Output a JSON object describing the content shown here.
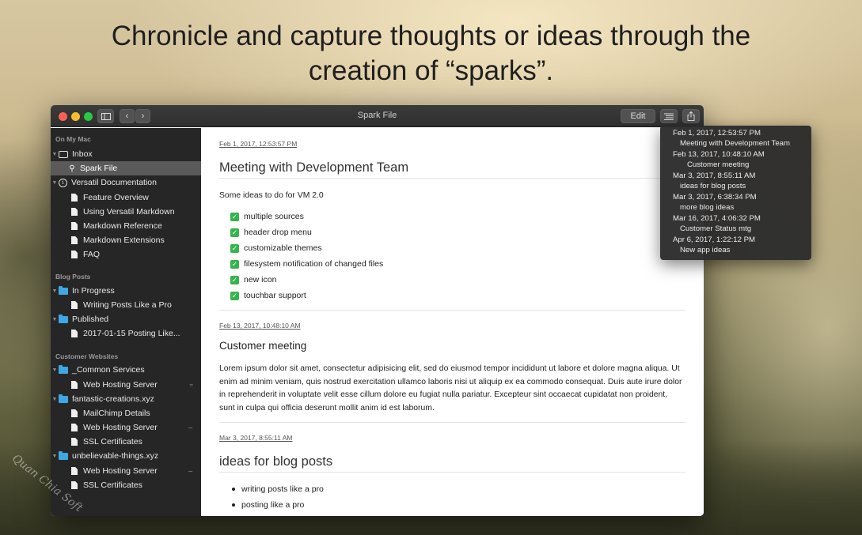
{
  "headline": {
    "line1": "Chronicle and capture thoughts or ideas through the",
    "line2": "creation of “sparks”."
  },
  "window": {
    "title": "Spark File",
    "toolbar": {
      "sidebar_icon": "sidebar-toggle-icon",
      "back": "‹",
      "forward": "›",
      "edit_label": "Edit",
      "outline_icon": "outline-list-icon",
      "share_icon": "share-icon"
    }
  },
  "sidebar": {
    "sections": [
      {
        "header": "On My Mac"
      },
      {
        "header": "Blog Posts"
      },
      {
        "header": "Customer Websites"
      }
    ],
    "items": [
      {
        "label": "Inbox",
        "icon": "inbox-icon"
      },
      {
        "label": "Spark File",
        "icon": "lightbulb-icon",
        "selected": true
      },
      {
        "label": "Versatil Documentation",
        "icon": "info-icon"
      },
      {
        "label": "Feature Overview",
        "icon": "document-icon"
      },
      {
        "label": "Using Versatil Markdown",
        "icon": "document-icon"
      },
      {
        "label": "Markdown Reference",
        "icon": "document-icon"
      },
      {
        "label": "Markdown Extensions",
        "icon": "document-icon"
      },
      {
        "label": "FAQ",
        "icon": "document-icon"
      },
      {
        "label": "In Progress",
        "icon": "folder-icon"
      },
      {
        "label": "Writing  Posts Like a Pro",
        "icon": "document-icon"
      },
      {
        "label": "Published",
        "icon": "folder-icon"
      },
      {
        "label": "2017-01-15 Posting Like...",
        "icon": "document-icon"
      },
      {
        "label": "_Common Services",
        "icon": "folder-icon"
      },
      {
        "label": "Web Hosting Server",
        "icon": "document-icon"
      },
      {
        "label": "fantastic-creations.xyz",
        "icon": "folder-icon"
      },
      {
        "label": "MailChimp Details",
        "icon": "document-icon"
      },
      {
        "label": "Web Hosting Server",
        "icon": "document-icon"
      },
      {
        "label": "SSL Certificates",
        "icon": "document-icon"
      },
      {
        "label": "unbelievable-things.xyz",
        "icon": "folder-icon"
      },
      {
        "label": "Web Hosting Server",
        "icon": "document-icon"
      },
      {
        "label": "SSL Certificates",
        "icon": "document-icon"
      }
    ]
  },
  "content": {
    "entries": [
      {
        "date": "Feb 1, 2017, 12:53:57 PM",
        "title": "Meeting with Development Team",
        "intro": "Some ideas to do for VM 2.0",
        "todos": [
          "multiple sources",
          "header drop menu",
          "customizable themes",
          "filesystem notification of changed files",
          "new icon",
          "touchbar support"
        ]
      },
      {
        "date": "Feb 13, 2017, 10:48:10 AM",
        "title": "Customer meeting",
        "body": "Lorem ipsum dolor sit amet, consectetur adipisicing elit, sed do eiusmod tempor incididunt ut labore et dolore magna aliqua. Ut enim ad minim veniam, quis nostrud exercitation ullamco laboris nisi ut aliquip ex ea commodo consequat. Duis aute irure dolor in reprehenderit in voluptate velit esse cillum dolore eu fugiat nulla pariatur. Excepteur sint occaecat cupidatat non proident, sunt in culpa qui officia deserunt mollit anim id est laborum."
      },
      {
        "date": "Mar 3, 2017, 8:55:11 AM",
        "title": "ideas for blog posts",
        "bullets": [
          "writing posts like a pro",
          "posting like a pro"
        ]
      }
    ]
  },
  "outline_popover": {
    "items": [
      {
        "date": "Feb 1, 2017, 12:53:57 PM",
        "title": "Meeting with Development Team"
      },
      {
        "date": "Feb 13, 2017, 10:48:10 AM",
        "title": "Customer meeting"
      },
      {
        "date": "Mar 3, 2017, 8:55:11 AM",
        "title": "ideas for blog posts"
      },
      {
        "date": "Mar 3, 2017, 6:38:34 PM",
        "title": "more blog ideas"
      },
      {
        "date": "Mar 16, 2017, 4:06:32 PM",
        "title": "Customer Status mtg"
      },
      {
        "date": "Apr 6, 2017, 1:22:12 PM",
        "title": "New app ideas"
      }
    ]
  },
  "watermark": "Quan Chia Soft",
  "colors": {
    "sidebar_bg": "#262626",
    "selection": "#5a5a5a",
    "folder": "#3fa7e3",
    "checkbox": "#34b44a"
  }
}
